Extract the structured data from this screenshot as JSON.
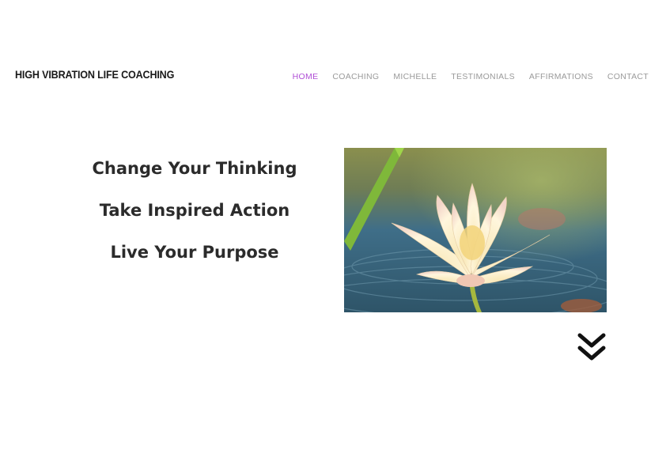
{
  "header": {
    "brand": "HIGH VIBRATION LIFE COACHING",
    "nav": [
      {
        "label": "HOME",
        "active": true
      },
      {
        "label": "COACHING",
        "active": false
      },
      {
        "label": "MICHELLE",
        "active": false
      },
      {
        "label": "TESTIMONIALS",
        "active": false
      },
      {
        "label": "AFFIRMATIONS",
        "active": false
      },
      {
        "label": "CONTACT",
        "active": false
      }
    ],
    "active_color": "#b04fd6",
    "inactive_color": "#9a9a9a"
  },
  "hero": {
    "lines": [
      "Change Your Thinking",
      "Take Inspired Action",
      "Live Your Purpose"
    ],
    "image": "lotus-flower-photo"
  },
  "scroll_icon": "double-chevron-down-icon"
}
